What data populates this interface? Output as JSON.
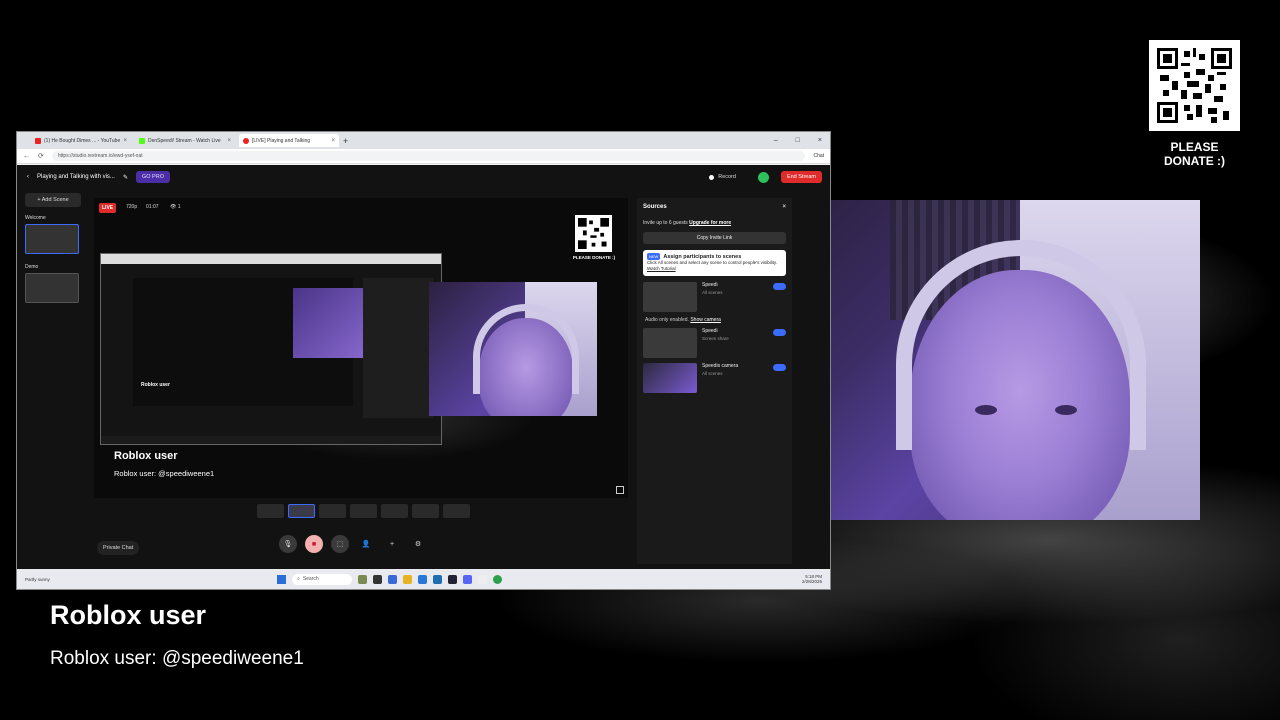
{
  "overlay": {
    "donate_text": "PLEASE DONATE :)",
    "title": "Roblox user",
    "subtitle": "Roblox user: @speediweene1"
  },
  "browser": {
    "tabs": [
      {
        "label": "(1) He Bought Dimes ... - YouTube"
      },
      {
        "label": "DenSpeedi! Stream - Watch Live"
      },
      {
        "label": "[LIVE] Playing and Talking"
      }
    ],
    "url": "https://studio.restream.io/ewd-ysef-oat",
    "chat_label": "Chat"
  },
  "studio": {
    "stream_title": "Playing and Talking with vis...",
    "go_pro": "GO PRO",
    "record": "Record",
    "end_stream": "End Stream",
    "add_scene": "+ Add Scene",
    "scenes": [
      {
        "label": "Welcome"
      },
      {
        "label": "Demo"
      }
    ],
    "live_badge": "LIVE",
    "resolution": "720p",
    "timer": "01:07",
    "viewers": "👁 1",
    "canvas_donate": "PLEASE DONATE :)",
    "canvas_title": "Roblox user",
    "canvas_subtitle": "Roblox user: @speediweene1",
    "private_chat": "Private Chat"
  },
  "sources": {
    "title": "Sources",
    "invite_text": "Invite up to 6 guests",
    "upgrade_link": "Upgrade for more",
    "copy_invite": "Copy Invite Link",
    "assign_new": "NEW",
    "assign_title": "Assign participants to scenes",
    "assign_body": "Click All scenes and select any scene to control people's visibility.",
    "assign_link": "Watch Tutorial",
    "items": [
      {
        "name": "Speedi",
        "scope": "All scenes"
      },
      {
        "name": "Speedi",
        "scope": "Screen share"
      },
      {
        "name": "Speedis camera",
        "scope": "All scenes"
      }
    ],
    "audio_note": "Audio only enabled.",
    "show_camera": "Show camera"
  },
  "taskbar": {
    "weather": "Partly sunny",
    "search": "Search",
    "time": "5:18 PM",
    "date": "2/28/2026"
  }
}
